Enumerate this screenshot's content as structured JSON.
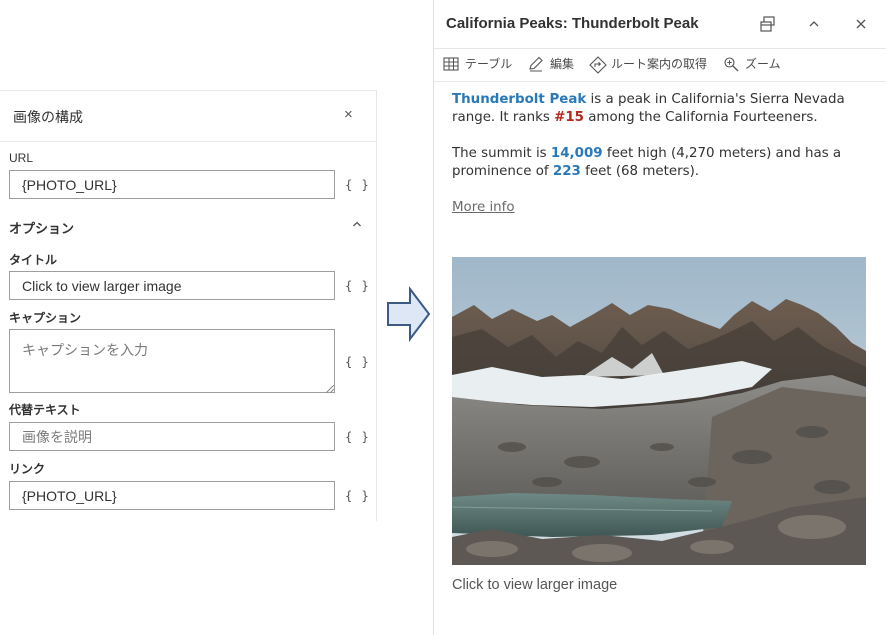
{
  "config": {
    "title": "画像の構成",
    "url_label": "URL",
    "url_value": "{PHOTO_URL}",
    "options_label": "オプション",
    "title_label": "タイトル",
    "title_value": "Click to view larger image",
    "caption_label": "キャプション",
    "caption_placeholder": "キャプションを入力",
    "alt_label": "代替テキスト",
    "alt_placeholder": "画像を説明",
    "link_label": "リンク",
    "link_value": "{PHOTO_URL}",
    "expression_glyph": "{ }",
    "close_glyph": "×"
  },
  "popup": {
    "title": "California Peaks: Thunderbolt Peak",
    "toolbar": {
      "table": "テーブル",
      "edit": "編集",
      "directions": "ルート案内の取得",
      "zoom": "ズーム"
    },
    "para1": {
      "peak": "Thunderbolt Peak",
      "t1": " is a peak in California's Sierra Nevada range. It ranks ",
      "rank": "#15",
      "t2": " among the California Fourteeners."
    },
    "para2": {
      "t1": "The summit is ",
      "height": "14,009",
      "t2": " feet high (4,270 meters) and has a prominence of ",
      "prominence": "223",
      "t3": " feet (68 meters)."
    },
    "more_info": "More info",
    "image_caption": "Click to view larger image"
  },
  "colors": {
    "accent_blue": "#2979b8",
    "accent_red": "#b3271c",
    "arrow_fill": "#dde7f5",
    "arrow_stroke": "#3b5a86"
  }
}
